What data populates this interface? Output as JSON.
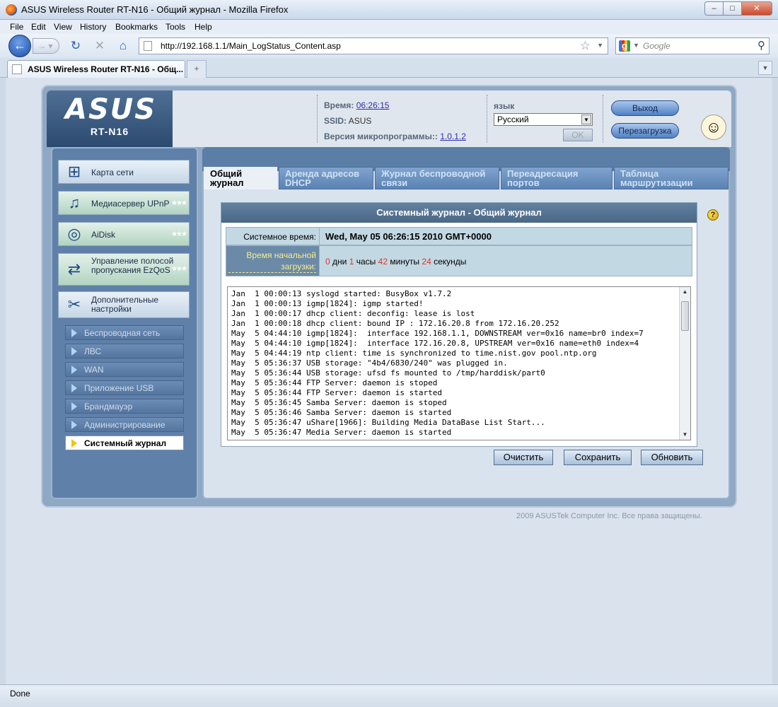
{
  "window": {
    "title": "ASUS Wireless Router RT-N16 - Общий журнал - Mozilla Firefox"
  },
  "menu": [
    "File",
    "Edit",
    "View",
    "History",
    "Bookmarks",
    "Tools",
    "Help"
  ],
  "nav": {
    "url": "http://192.168.1.1/Main_LogStatus_Content.asp",
    "search_placeholder": "Google"
  },
  "browser_tab": {
    "title": "ASUS Wireless Router RT-N16 - Общ..."
  },
  "header": {
    "logo": "ASUS",
    "model": "RT-N16",
    "time_label": "Время:",
    "time_value": "06:26:15",
    "ssid_label": "SSID:",
    "ssid_value": "ASUS",
    "fw_label": "Версия микропрограммы::",
    "fw_value": "1.0.1.2",
    "lang_label": "язык",
    "lang_value": "Русский",
    "ok_label": "OK",
    "logout_label": "Выход",
    "reboot_label": "Перезагрузка"
  },
  "sidebar": {
    "items": [
      {
        "label": "Карта сети",
        "icon": "network-map-icon"
      },
      {
        "label": "Медиасервер UPnP",
        "icon": "media-server-icon"
      },
      {
        "label": "AiDisk",
        "icon": "aidisk-icon"
      },
      {
        "label": "Управление полосой пропускания EzQoS",
        "icon": "qos-icon"
      },
      {
        "label": "Дополнительные настройки",
        "icon": "tools-icon"
      }
    ],
    "subitems": [
      {
        "label": "Беспроводная сеть"
      },
      {
        "label": "ЛВС"
      },
      {
        "label": "WAN"
      },
      {
        "label": "Приложение USB"
      },
      {
        "label": "Брандмауэр"
      },
      {
        "label": "Администрирование"
      },
      {
        "label": "Системный журнал"
      }
    ]
  },
  "tabs": [
    {
      "label": "Общий журнал"
    },
    {
      "label": "Аренда адресов DHCP"
    },
    {
      "label": "Журнал беспроводной связи"
    },
    {
      "label": "Переадресация портов"
    },
    {
      "label": "Таблица маршрутизации"
    }
  ],
  "log": {
    "title": "Системный журнал - Общий журнал",
    "systime_label": "Системное время:",
    "systime_value": "Wed, May 05  06:26:15  2010 GMT+0000",
    "uptime_label": "Время начальной загрузки:",
    "uptime": {
      "days": "0",
      "days_unit": "дни",
      "hours": "1",
      "hours_unit": "часы",
      "minutes": "42",
      "minutes_unit": "минуты",
      "seconds": "24",
      "seconds_unit": "секунды"
    },
    "lines": [
      "Jan  1 00:00:13 syslogd started: BusyBox v1.7.2",
      "Jan  1 00:00:13 igmp[1824]: igmp started!",
      "Jan  1 00:00:17 dhcp client: deconfig: lease is lost",
      "Jan  1 00:00:18 dhcp client: bound IP : 172.16.20.8 from 172.16.20.252",
      "May  5 04:44:10 igmp[1824]:  interface 192.168.1.1, DOWNSTREAM ver=0x16 name=br0 index=7",
      "May  5 04:44:10 igmp[1824]:  interface 172.16.20.8, UPSTREAM ver=0x16 name=eth0 index=4",
      "May  5 04:44:19 ntp client: time is synchronized to time.nist.gov pool.ntp.org",
      "May  5 05:36:37 USB storage: \"4b4/6830/240\" was plugged in.",
      "May  5 05:36:44 USB storage: ufsd fs mounted to /tmp/harddisk/part0",
      "May  5 05:36:44 FTP Server: daemon is stoped",
      "May  5 05:36:44 FTP Server: daemon is started",
      "May  5 05:36:45 Samba Server: daemon is stoped",
      "May  5 05:36:46 Samba Server: daemon is started",
      "May  5 05:36:47 uShare[1966]: Building Media DataBase List Start...",
      "May  5 05:36:47 Media Server: daemon is started"
    ],
    "buttons": {
      "clear": "Очистить",
      "save": "Сохранить",
      "refresh": "Обновить"
    }
  },
  "footer": {
    "copyright": "2009 ASUSTek Computer Inc. Все права защищены."
  },
  "status": {
    "text": "Done"
  }
}
